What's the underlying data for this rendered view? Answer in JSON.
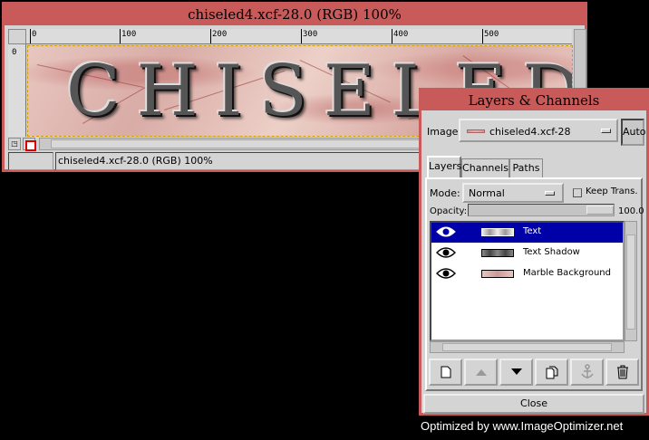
{
  "image_window": {
    "title": "chiseled4.xcf-28.0 (RGB) 100%",
    "ruler_labels": [
      "0",
      "100",
      "200",
      "300",
      "400",
      "500"
    ],
    "vruler_label": "0",
    "canvas_text": "CHISELED",
    "status_text": "chiseled4.xcf-28.0 (RGB) 100%"
  },
  "layers_dialog": {
    "title": "Layers & Channels",
    "image_label": "Image:",
    "image_value": "chiseled4.xcf-28",
    "auto_label": "Auto",
    "tabs": [
      {
        "label": "Layers"
      },
      {
        "label": "Channels"
      },
      {
        "label": "Paths"
      }
    ],
    "mode_label": "Mode:",
    "mode_value": "Normal",
    "keep_trans_label": "Keep Trans.",
    "keep_trans_checked": false,
    "opacity_label": "Opacity:",
    "opacity_value": "100.0",
    "layers": [
      {
        "name": "Text",
        "selected": true,
        "visible": true
      },
      {
        "name": "Text Shadow",
        "selected": false,
        "visible": true
      },
      {
        "name": "Marble Background",
        "selected": false,
        "visible": true
      }
    ],
    "buttons": [
      {
        "icon": "new-layer-icon"
      },
      {
        "icon": "raise-layer-icon"
      },
      {
        "icon": "lower-layer-icon"
      },
      {
        "icon": "duplicate-layer-icon"
      },
      {
        "icon": "anchor-layer-icon"
      },
      {
        "icon": "delete-layer-icon"
      }
    ],
    "close_label": "Close"
  },
  "watermark": "Optimized by www.ImageOptimizer.net",
  "colors": {
    "title_bar": "#c85a5a",
    "selection": "#0000a8",
    "background": "#000000"
  }
}
